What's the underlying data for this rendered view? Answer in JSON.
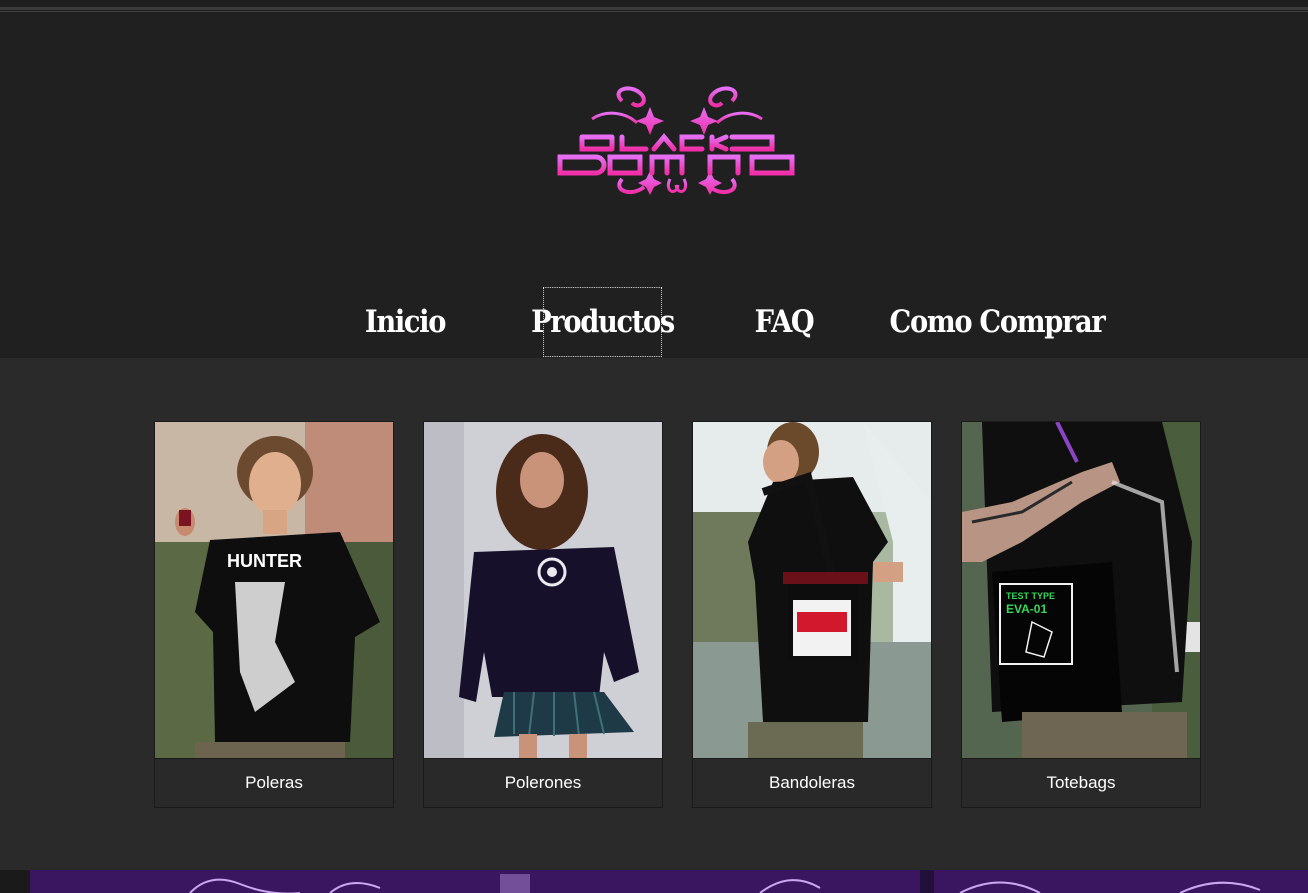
{
  "brand": {
    "logo_text": "BLACK DOMINO",
    "logo_colors": [
      "#e26af0",
      "#f02fa8"
    ]
  },
  "nav": {
    "items": [
      {
        "label": "Inicio"
      },
      {
        "label": "Productos"
      },
      {
        "label": "FAQ"
      },
      {
        "label": "Como Comprar"
      }
    ],
    "focused": "Productos"
  },
  "products": [
    {
      "label": "Poleras",
      "photo": "man-black-tshirt-hunter-print"
    },
    {
      "label": "Polerones",
      "photo": "woman-black-hoodie-plaid-skirt"
    },
    {
      "label": "Bandoleras",
      "photo": "man-crossbody-bag-red-print"
    },
    {
      "label": "Totebags",
      "photo": "tattooed-arm-black-totebag-green-print"
    }
  ],
  "colors": {
    "header_bg": "#202020",
    "main_bg": "#2a2a2a",
    "banner_bg": "#3a1560",
    "text": "#ffffff"
  }
}
